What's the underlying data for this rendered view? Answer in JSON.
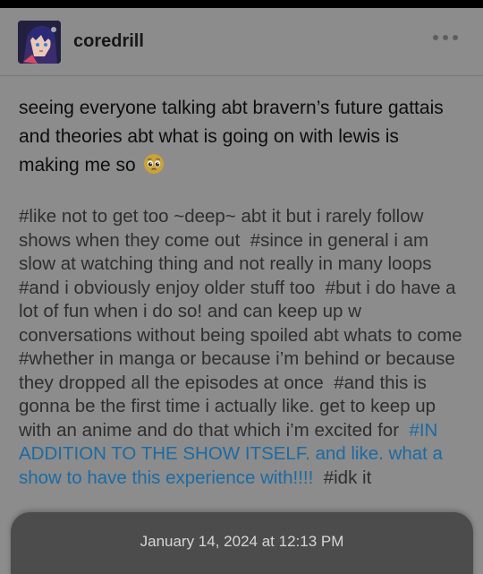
{
  "post": {
    "username": "coredrill",
    "more_icon": "ellipsis-icon",
    "text": "seeing everyone talking abt bravern’s future gattais and theories abt what is going on with lewis is making me so",
    "emoji": "pleading-face-emoji",
    "tags": [
      {
        "text": "#like not to get too ~deep~ abt it but i rarely follow shows when they come out",
        "highlight": false
      },
      {
        "text": "#since in general i am slow at watching thing and not really in many loops",
        "highlight": false
      },
      {
        "text": "#and i obviously enjoy older stuff too",
        "highlight": false
      },
      {
        "text": "#but i do have a lot of fun when i do so! and can keep up w conversations without being spoiled abt whats to come",
        "highlight": false
      },
      {
        "text": "#whether in manga or because i’m behind or because they dropped all the episodes at once",
        "highlight": false
      },
      {
        "text": "#and this is gonna be the first time i actually like. get to keep up with an anime and do that which i’m excited for",
        "highlight": false
      },
      {
        "text": "#IN ADDITION TO THE SHOW ITSELF. and like. what a show to have this experience with!!!!",
        "highlight": true
      },
      {
        "text": "#idk it",
        "highlight": false
      }
    ],
    "timestamp": "January 14, 2024 at 12:13 PM"
  },
  "colors": {
    "dimmed_background": "#8c8c8c",
    "tag_link": "#1c6aa3",
    "sheet": "#4c4c4c"
  }
}
